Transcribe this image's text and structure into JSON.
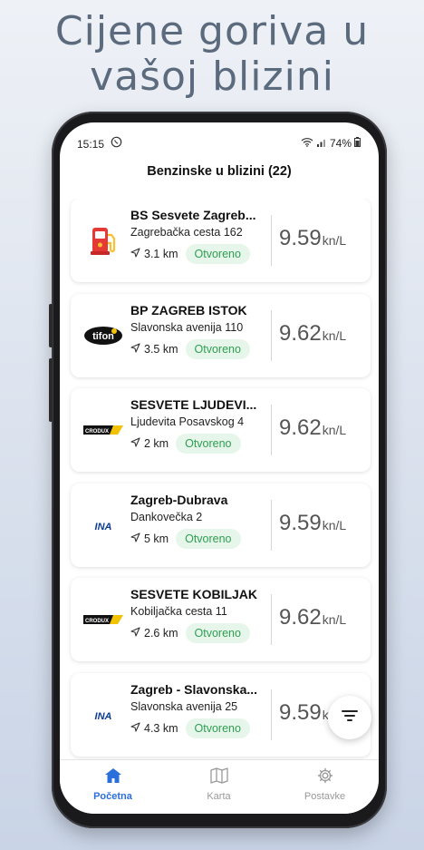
{
  "headline": {
    "line1": "Cijene goriva u",
    "line2": "vašoj blizini"
  },
  "status": {
    "time": "15:15",
    "battery": "74%"
  },
  "app": {
    "title": "Benzinske u blizini (22)"
  },
  "stations": [
    {
      "name": "BS Sesvete Zagreb...",
      "address": "Zagrebačka cesta 162",
      "distance": "3.1 km",
      "status": "Otvoreno",
      "price": "9.59",
      "unit": "kn/L",
      "logo": "fuel-pump-icon"
    },
    {
      "name": "BP ZAGREB ISTOK",
      "address": "Slavonska avenija 110",
      "distance": "3.5 km",
      "status": "Otvoreno",
      "price": "9.62",
      "unit": "kn/L",
      "logo": "tifon-logo",
      "logo_text": "tifon"
    },
    {
      "name": "SESVETE LJUDEVI...",
      "address": "Ljudevita Posavskog 4",
      "distance": "2 km",
      "status": "Otvoreno",
      "price": "9.62",
      "unit": "kn/L",
      "logo": "crodux-logo",
      "logo_text": "CRODUX"
    },
    {
      "name": "Zagreb-Dubrava",
      "address": "Dankovečka 2",
      "distance": "5 km",
      "status": "Otvoreno",
      "price": "9.59",
      "unit": "kn/L",
      "logo": "ina-logo",
      "logo_text": "INA"
    },
    {
      "name": "SESVETE KOBILJAK",
      "address": "Kobiljačka cesta 11",
      "distance": "2.6 km",
      "status": "Otvoreno",
      "price": "9.62",
      "unit": "kn/L",
      "logo": "crodux-logo",
      "logo_text": "CRODUX"
    },
    {
      "name": "Zagreb - Slavonska...",
      "address": "Slavonska avenija 25",
      "distance": "4.3 km",
      "status": "Otvoreno",
      "price": "9.59",
      "unit": "kn/L",
      "logo": "ina-logo",
      "logo_text": "INA"
    }
  ],
  "nav": {
    "home": "Početna",
    "map": "Karta",
    "settings": "Postavke"
  },
  "colors": {
    "accent": "#2a6fdb",
    "open_bg": "#e6f6ea",
    "open_text": "#2f9e52"
  }
}
